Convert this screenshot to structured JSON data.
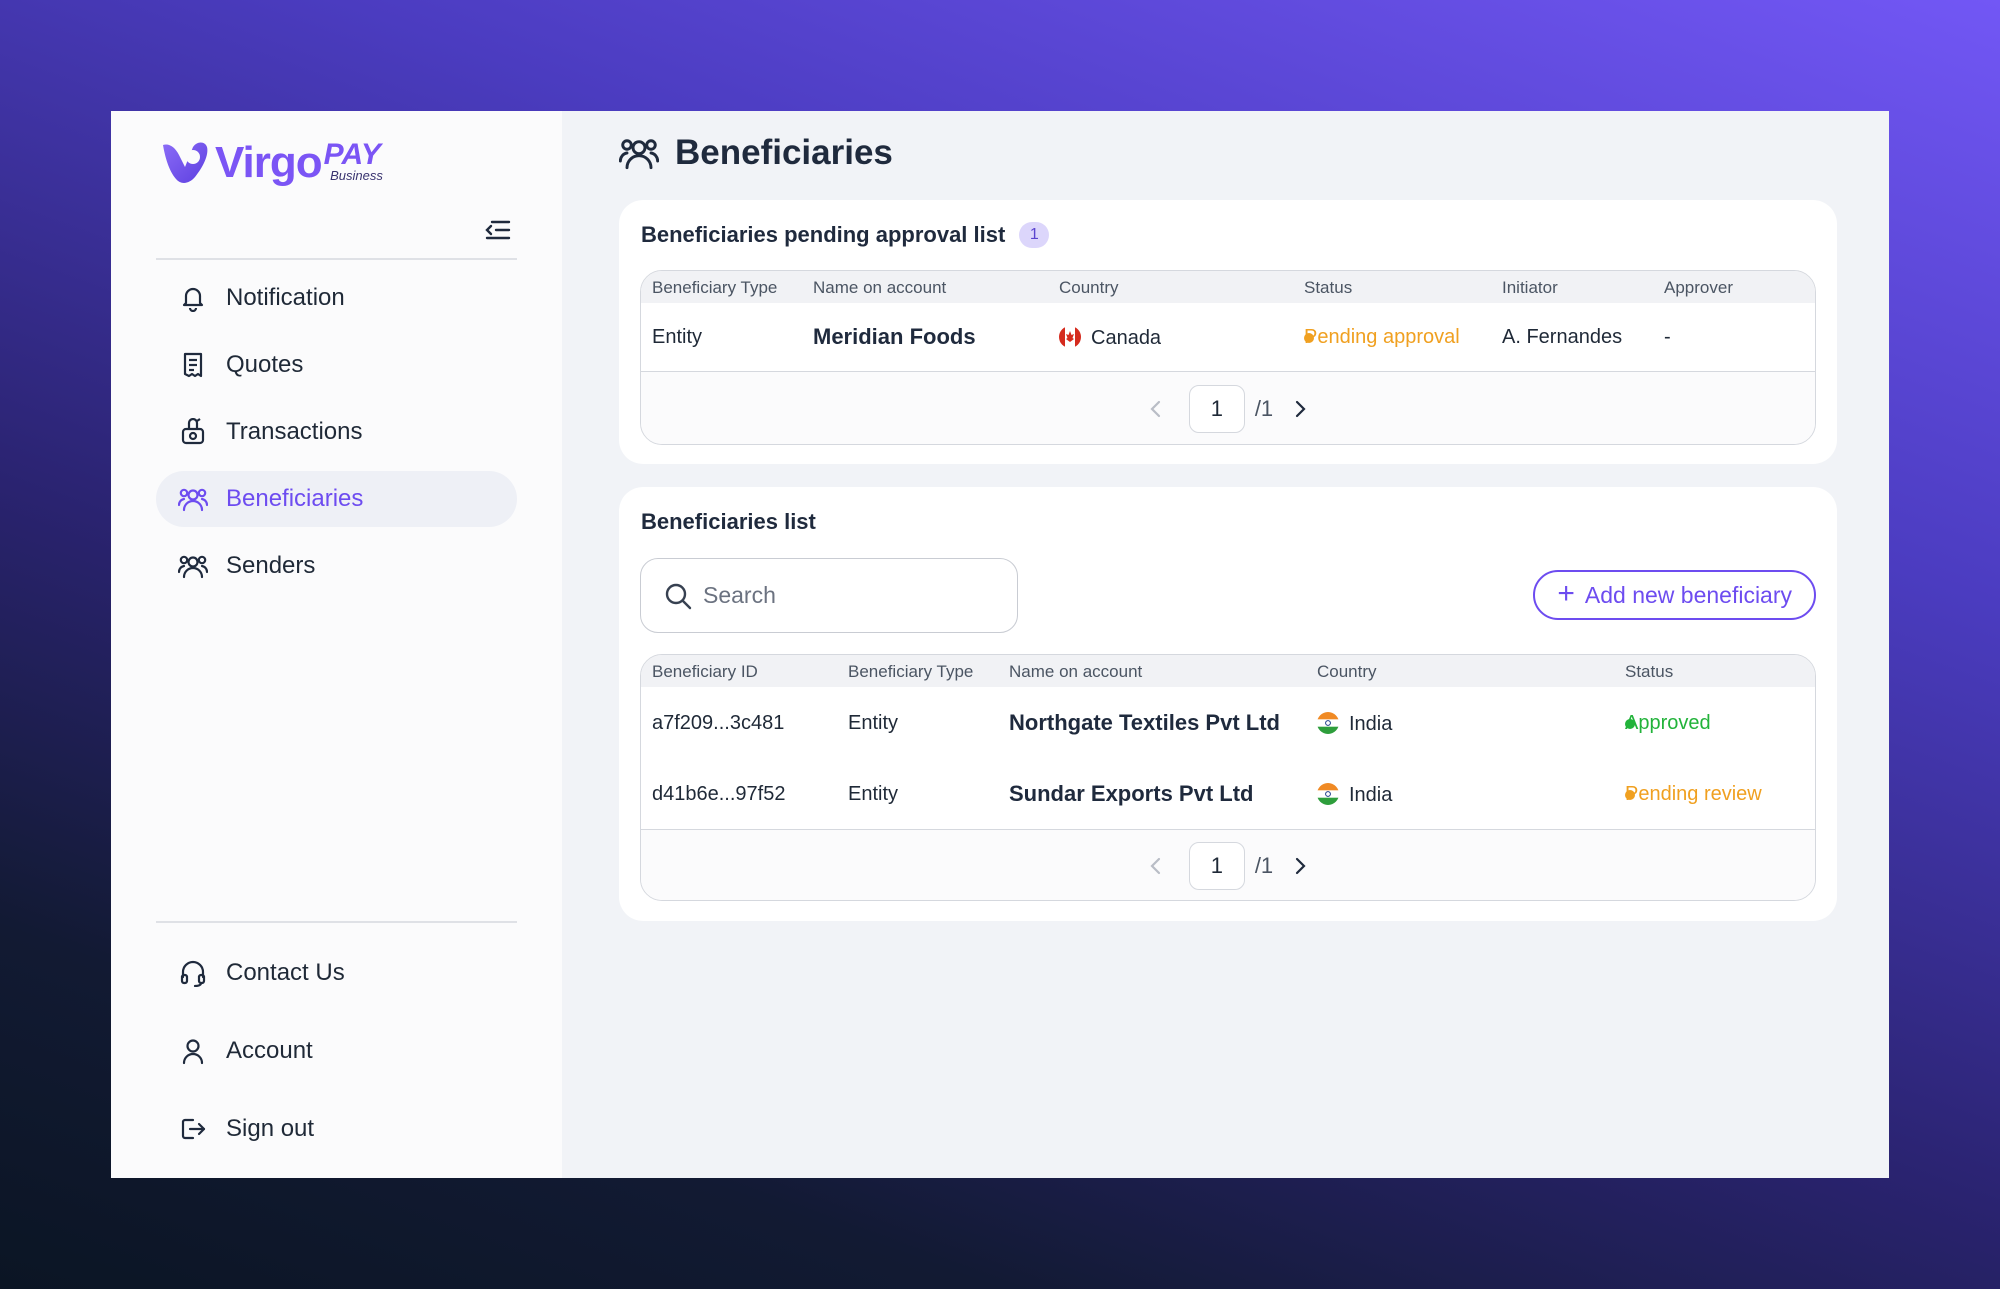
{
  "brand": {
    "name": "Virgo",
    "product": "PAY",
    "tier": "Business",
    "accent": "#6d4cf0"
  },
  "sidebar": {
    "items": [
      {
        "label": "Notification",
        "icon": "bell-icon"
      },
      {
        "label": "Quotes",
        "icon": "receipt-icon"
      },
      {
        "label": "Transactions",
        "icon": "money-bag-icon"
      },
      {
        "label": "Beneficiaries",
        "icon": "users-icon",
        "active": true
      },
      {
        "label": "Senders",
        "icon": "users-icon"
      }
    ],
    "bottom_items": [
      {
        "label": "Contact Us",
        "icon": "headset-icon"
      },
      {
        "label": "Account",
        "icon": "user-icon"
      },
      {
        "label": "Sign out",
        "icon": "sign-out-icon"
      }
    ]
  },
  "page": {
    "title": "Beneficiaries"
  },
  "pending": {
    "title": "Beneficiaries pending approval list",
    "count": "1",
    "columns": [
      "Beneficiary Type",
      "Name on account",
      "Country",
      "Status",
      "Initiator",
      "Approver"
    ],
    "rows": [
      {
        "type": "Entity",
        "name": "Meridian Foods",
        "country": "Canada",
        "status": "Pending approval",
        "status_color": "#f0a020",
        "initiator": "A. Fernandes",
        "approver": "-"
      }
    ],
    "pager": {
      "page": "1",
      "total": "/1"
    }
  },
  "list": {
    "title": "Beneficiaries list",
    "search_placeholder": "Search",
    "add_button": "Add new beneficiary",
    "columns": [
      "Beneficiary ID",
      "Beneficiary Type",
      "Name on account",
      "Country",
      "Status"
    ],
    "rows": [
      {
        "id": "a7f209...3c481",
        "type": "Entity",
        "name": "Northgate Textiles Pvt Ltd",
        "country": "India",
        "status": "Approved",
        "status_color": "#22b33a"
      },
      {
        "id": "d41b6e...97f52",
        "type": "Entity",
        "name": "Sundar Exports Pvt Ltd",
        "country": "India",
        "status": "Pending review",
        "status_color": "#f0a020"
      }
    ],
    "pager": {
      "page": "1",
      "total": "/1"
    }
  }
}
